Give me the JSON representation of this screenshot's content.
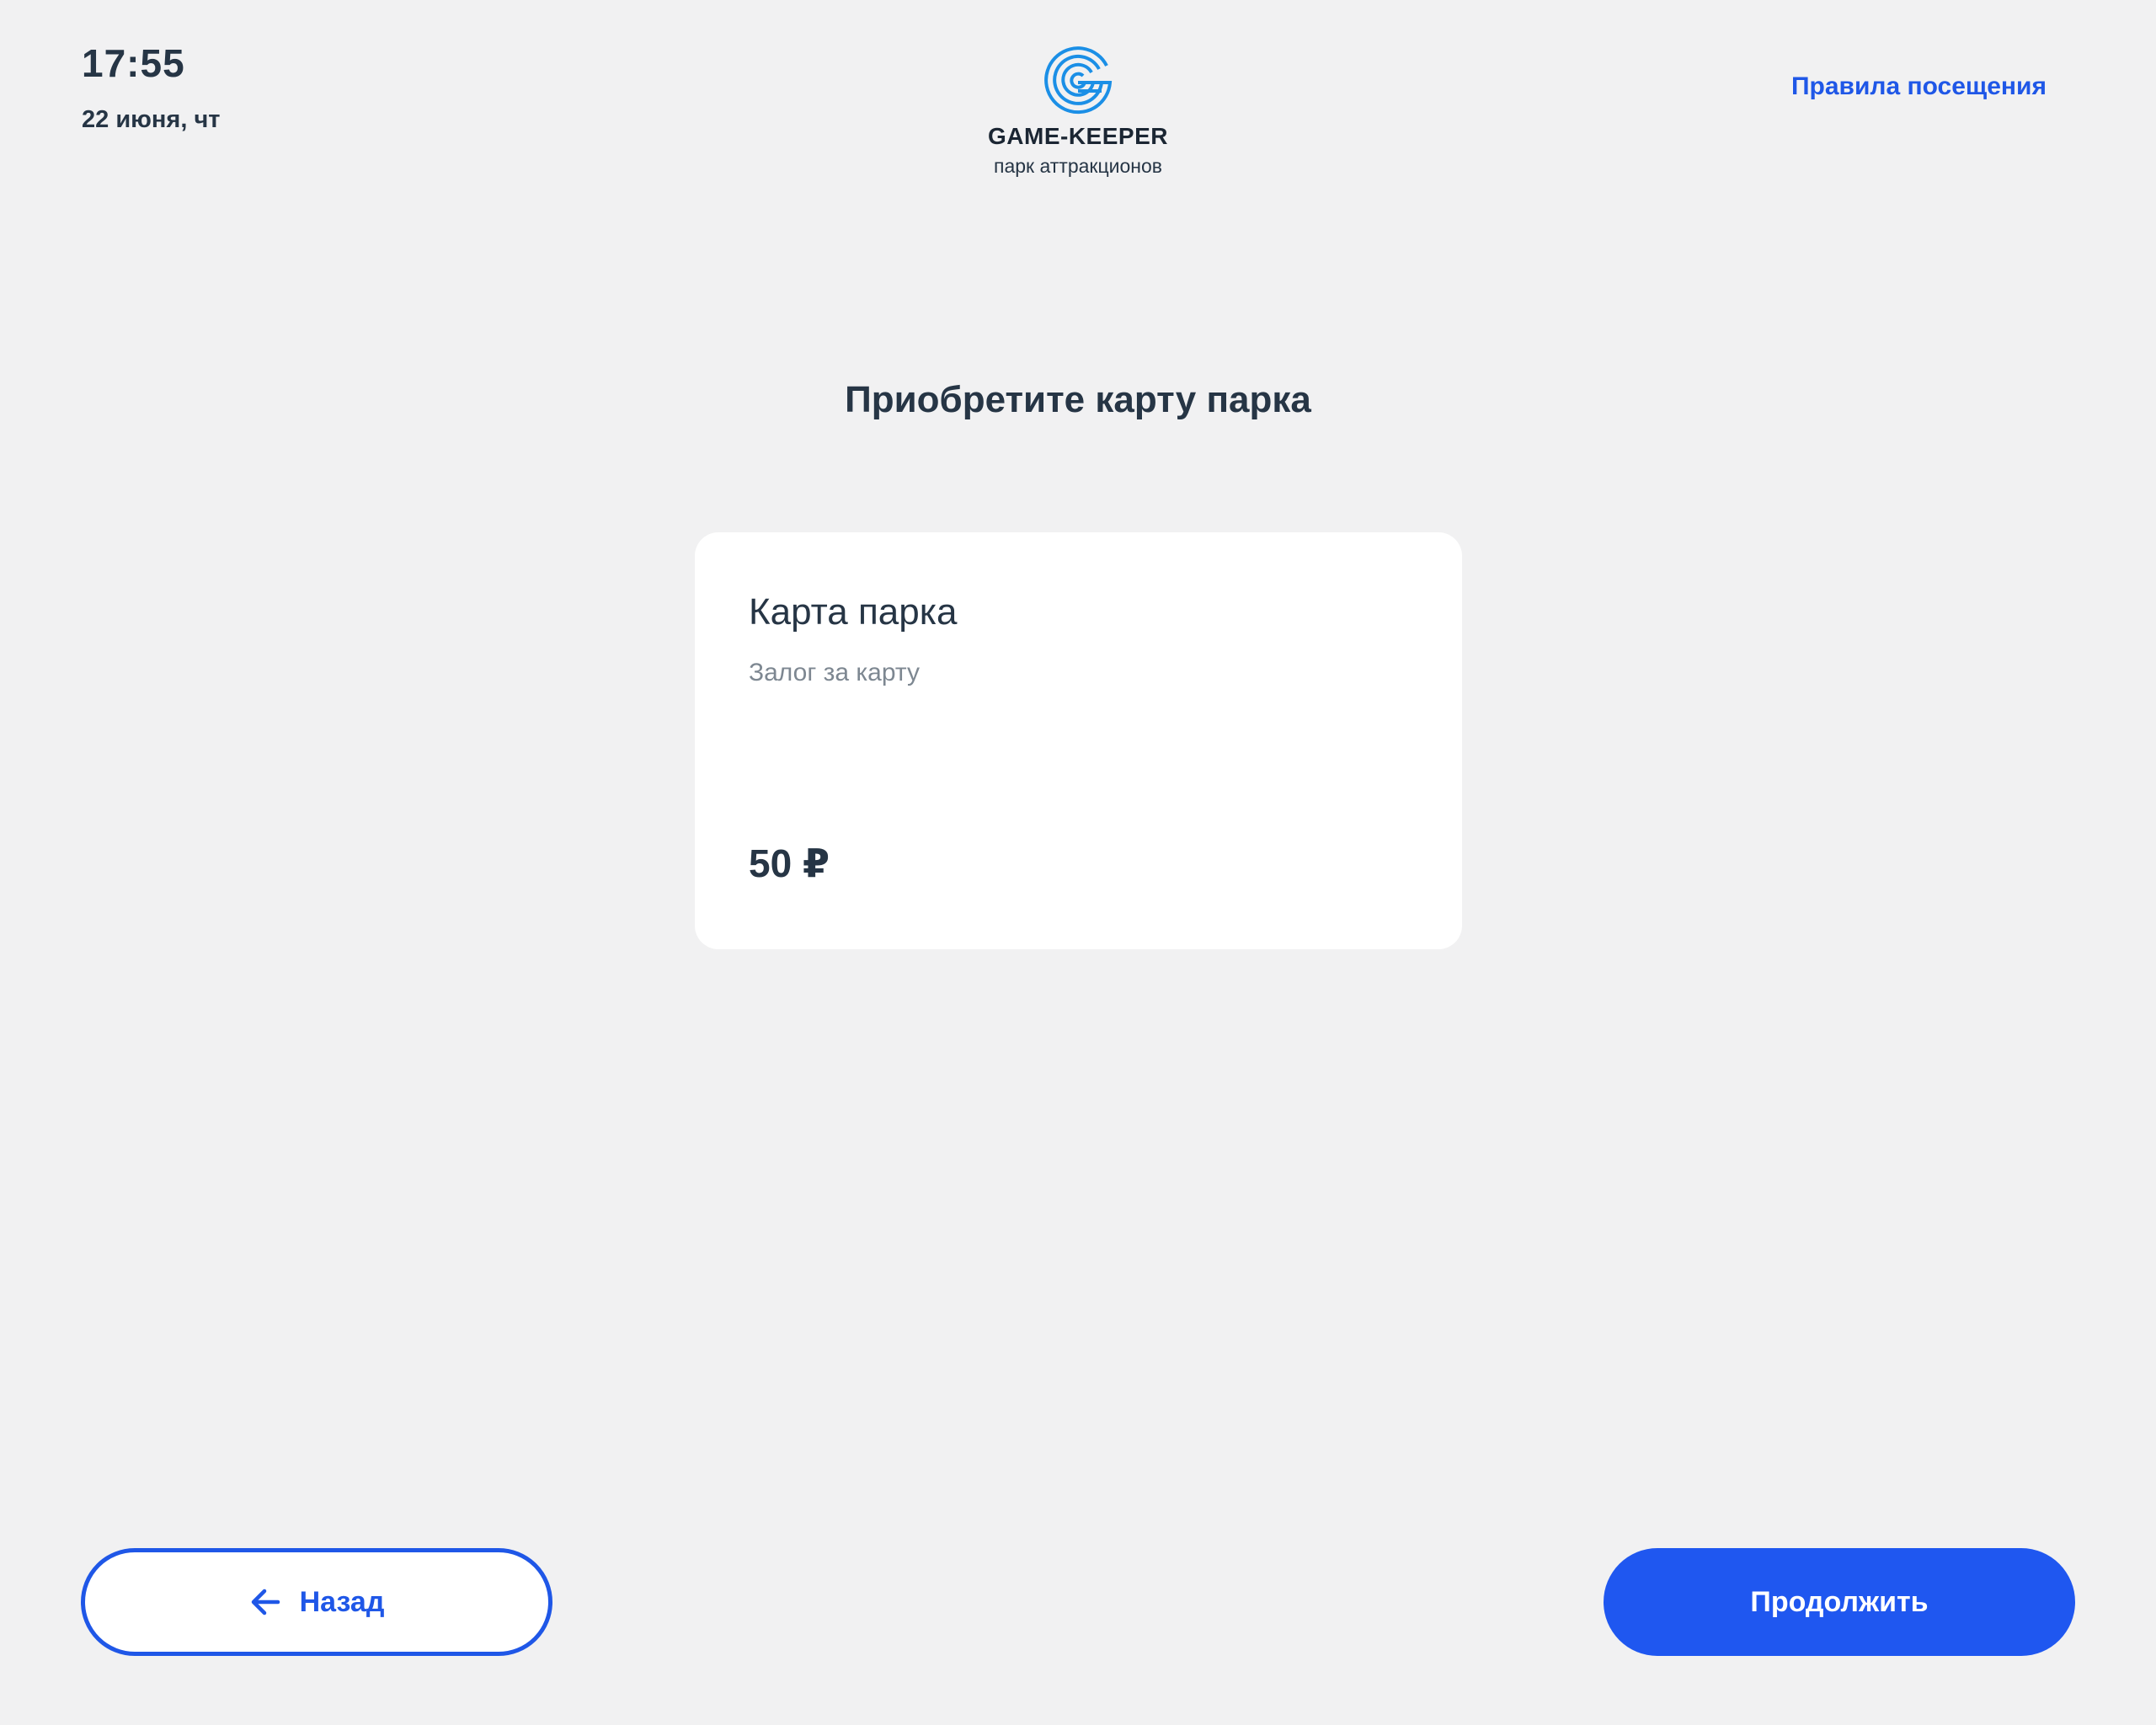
{
  "header": {
    "time": "17:55",
    "date": "22 июня, чт",
    "logo": {
      "icon": "game-keeper-logo-icon",
      "name": "GAME-KEEPER",
      "subtitle": "парк аттракционов"
    },
    "rules_link": "Правила посещения"
  },
  "main": {
    "title": "Приобретите карту парка",
    "card": {
      "title": "Карта парка",
      "subtitle": "Залог за карту",
      "price": "50 ₽"
    }
  },
  "footer": {
    "back_label": "Назад",
    "back_icon": "arrow-left-icon",
    "continue_label": "Продолжить"
  },
  "colors": {
    "accent": "#1f57e7",
    "background": "#f1f1f2",
    "text": "#263545",
    "muted": "#7d8791",
    "logo": "#1b8fe6"
  }
}
